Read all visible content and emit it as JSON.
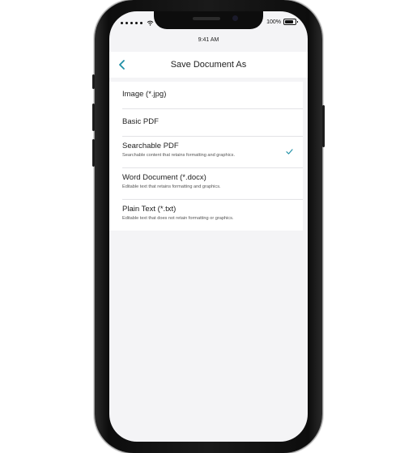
{
  "status_bar": {
    "battery_percent": "100%",
    "time": "9:41 AM",
    "battery_level": 1.0
  },
  "nav": {
    "title": "Save Document As",
    "back_icon": "chevron-left-icon"
  },
  "options": [
    {
      "title": "Image (*.jpg)",
      "subtitle": "",
      "selected": false
    },
    {
      "title": "Basic PDF",
      "subtitle": "",
      "selected": false
    },
    {
      "title": "Searchable PDF",
      "subtitle": "Searchable content that retains formatting and graphics.",
      "selected": true
    },
    {
      "title": "Word Document (*.docx)",
      "subtitle": "Editable text that retains formatting and graphics.",
      "selected": false
    },
    {
      "title": "Plain Text (*.txt)",
      "subtitle": "Editable text that does not retain formatting or graphics.",
      "selected": false
    }
  ],
  "colors": {
    "accent": "#1f8fa6",
    "check": "#1f8fa6",
    "screen_bg": "#f4f4f6"
  }
}
